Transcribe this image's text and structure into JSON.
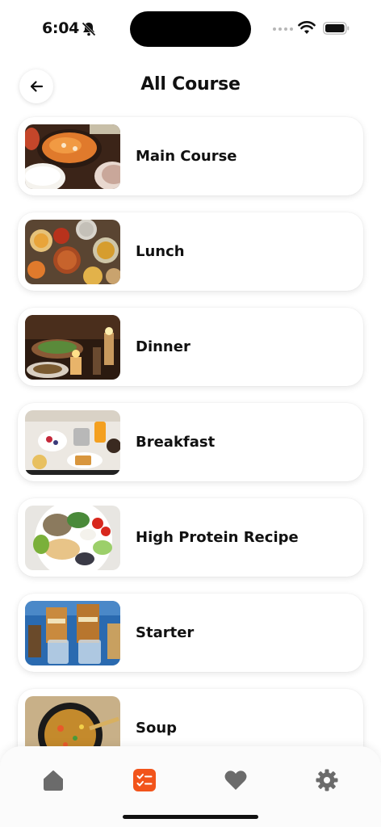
{
  "status_bar": {
    "time": "6:04"
  },
  "header": {
    "title": "All Course"
  },
  "courses": [
    {
      "label": "Main Course"
    },
    {
      "label": "Lunch"
    },
    {
      "label": "Dinner"
    },
    {
      "label": "Breakfast"
    },
    {
      "label": "High Protein Recipe"
    },
    {
      "label": "Starter"
    },
    {
      "label": "Soup"
    }
  ],
  "bottom_nav": {
    "items": [
      {
        "icon": "home-icon",
        "active": false
      },
      {
        "icon": "checklist-icon",
        "active": true
      },
      {
        "icon": "heart-icon",
        "active": false
      },
      {
        "icon": "gear-icon",
        "active": false
      }
    ]
  },
  "colors": {
    "accent": "#f2541b",
    "nav_icon": "#6b6b6b"
  }
}
